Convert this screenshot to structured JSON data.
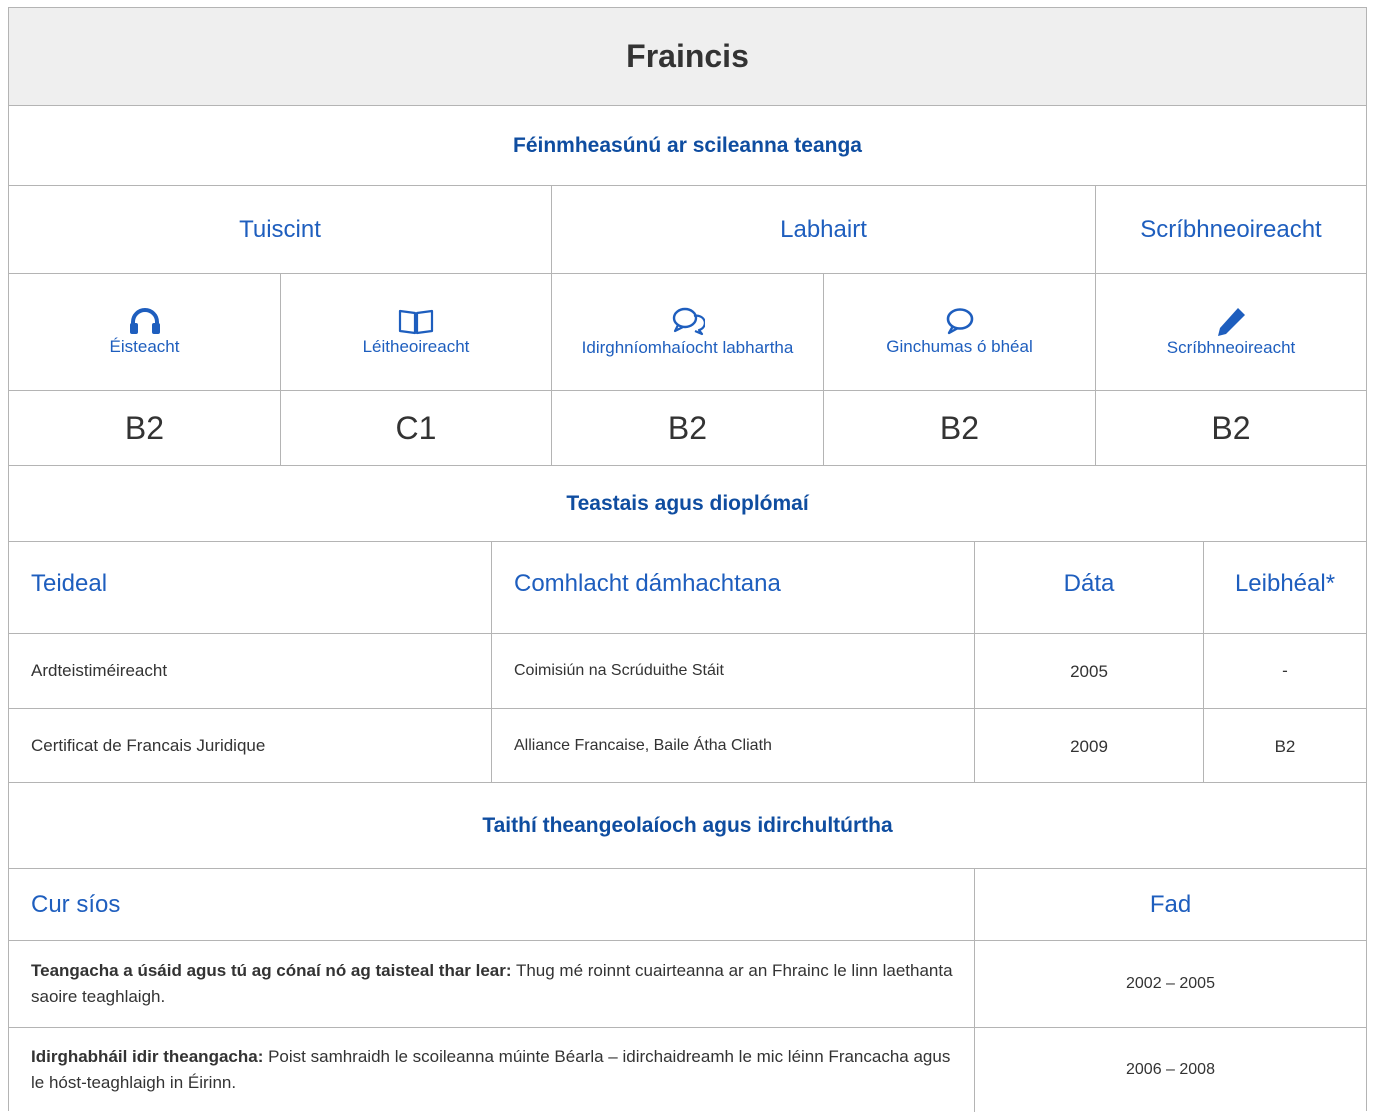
{
  "title": "Fraincis",
  "self_assessment": {
    "heading": "Féinmheasúnú ar scileanna teanga",
    "groups": [
      "Tuiscint",
      "Labhairt",
      "Scríbhneoireacht"
    ],
    "skills": [
      {
        "label": "Éisteacht",
        "icon": "headphones-icon"
      },
      {
        "label": "Léitheoireacht",
        "icon": "book-icon"
      },
      {
        "label": "Idirghníomhaíocht labhartha",
        "icon": "chat-bubbles-icon"
      },
      {
        "label": "Ginchumas ó bhéal",
        "icon": "speech-bubble-icon"
      },
      {
        "label": "Scríbhneoireacht",
        "icon": "pencil-icon"
      }
    ],
    "levels": [
      "B2",
      "C1",
      "B2",
      "B2",
      "B2"
    ]
  },
  "certificates": {
    "heading": "Teastais agus dioplómaí",
    "columns": [
      "Teideal",
      "Comhlacht dámhachtana",
      "Dáta",
      "Leibhéal*"
    ],
    "rows": [
      [
        "Ardteistiméireacht",
        "Coimisiún na Scrúduithe Stáit",
        "2005",
        "-"
      ],
      [
        "Certificat de Francais Juridique",
        "Alliance Francaise, Baile Átha Cliath",
        "2009",
        "B2"
      ]
    ]
  },
  "experience": {
    "heading": "Taithí theangeolaíoch agus idirchultúrtha",
    "columns": [
      "Cur síos",
      "Fad"
    ],
    "rows": [
      {
        "label": "Teangacha a úsáid agus tú ag cónaí nó ag taisteal thar lear:",
        "text": " Thug mé roinnt cuairteanna ar an Fhrainc le linn laethanta saoire teaghlaigh.",
        "duration": "2002 – 2005"
      },
      {
        "label": "Idirghabháil idir theangacha:",
        "text": " Poist samhraidh le scoileanna múinte Béarla – idirchaidreamh le mic léinn Francacha agus le hóst-teaghlaigh in Éirinn.",
        "duration": "2006 – 2008"
      }
    ]
  },
  "colors": {
    "accent": "#1e5ebe",
    "heading": "#0f4da0",
    "border": "#b4b4b4",
    "title_bg": "#efefef"
  }
}
